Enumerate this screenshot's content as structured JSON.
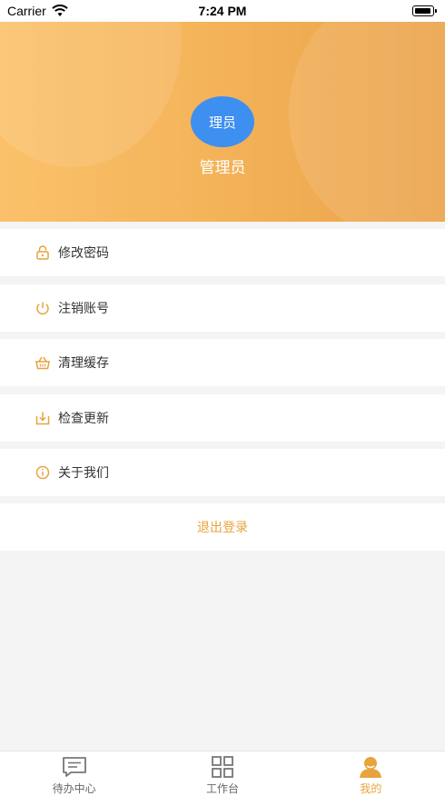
{
  "status_bar": {
    "carrier": "Carrier",
    "time": "7:24 PM"
  },
  "profile": {
    "avatar_text": "理员",
    "name": "管理员",
    "avatar_color": "#3d8ff0"
  },
  "menu": [
    {
      "label": "修改密码",
      "icon": "lock-icon"
    },
    {
      "label": "注销账号",
      "icon": "power-icon"
    },
    {
      "label": "清理缓存",
      "icon": "basket-icon"
    },
    {
      "label": "检查更新",
      "icon": "download-icon"
    },
    {
      "label": "关于我们",
      "icon": "info-icon"
    }
  ],
  "logout_label": "退出登录",
  "tabs": [
    {
      "label": "待办中心",
      "icon": "message-icon",
      "active": false
    },
    {
      "label": "工作台",
      "icon": "grid-icon",
      "active": false
    },
    {
      "label": "我的",
      "icon": "person-icon",
      "active": true
    }
  ],
  "colors": {
    "accent": "#e8a33d",
    "header_start": "#fbc16a",
    "header_end": "#eba24a"
  }
}
